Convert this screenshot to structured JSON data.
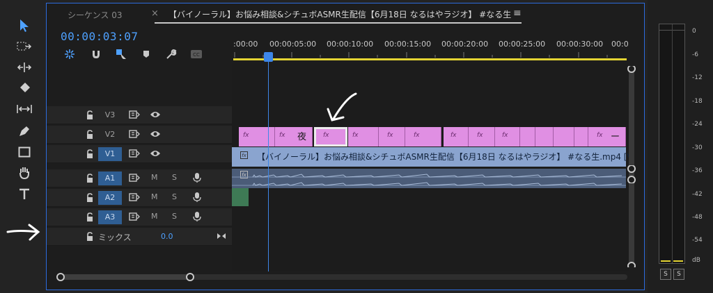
{
  "tabs": {
    "inactive": "シーケンス 03",
    "close": "×",
    "active": "【バイノーラル】お悩み相談&シチュボASMR生配信【6月18日 なるはやラジオ】 #なる生",
    "menu": "≡"
  },
  "timecode": "00:00:03:07",
  "ruler": {
    "labels": [
      ":00:00",
      "00:00:05:00",
      "00:00:10:00",
      "00:00:15:00",
      "00:00:20:00",
      "00:00:25:00",
      "00:00:30:00",
      "00:0"
    ]
  },
  "tracks": {
    "v3": "V3",
    "v2": "V2",
    "v1": "V1",
    "a1": "A1",
    "a2": "A2",
    "a3": "A3",
    "mute": "M",
    "solo": "S",
    "mix_label": "ミックス",
    "mix_value": "0.0"
  },
  "clips": {
    "fx": "fx",
    "v2_text_1": "夜",
    "v2_text_2": "ー",
    "v1_label": "【バイノーラル】お悩み相談&シチュボASMR生配信【6月18日 なるはやラジオ】 #なる生.mp4 [V"
  },
  "meter": {
    "ticks": [
      "0",
      "-6",
      "-12",
      "-18",
      "-24",
      "-30",
      "-36",
      "-42",
      "-48",
      "-54",
      "dB"
    ],
    "solo_left": "S",
    "solo_right": "S"
  },
  "colors": {
    "accent": "#2d6cdf",
    "timecode": "#4ea1ff",
    "v2_clip": "#e08fe3",
    "v1_clip": "#8aa4cf",
    "a1_clip": "#4b5c78",
    "a2_clip": "#3e7a55",
    "work_area": "#e4d433"
  }
}
